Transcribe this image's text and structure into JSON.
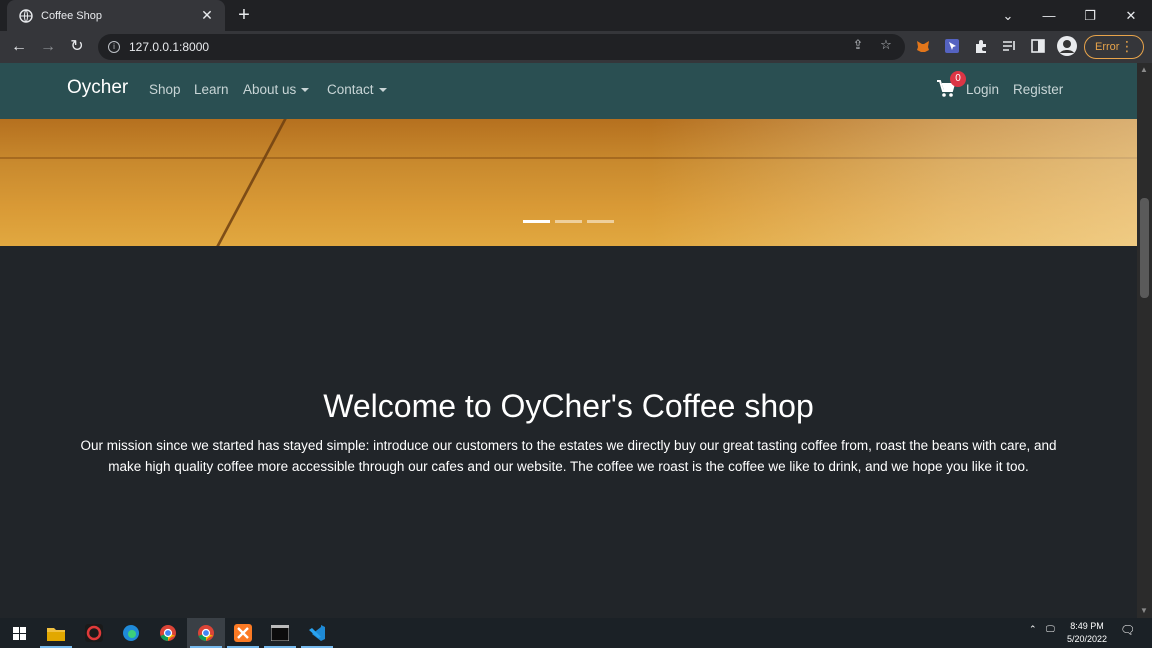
{
  "browser": {
    "tab_title": "Coffee Shop",
    "url": "127.0.0.1:8000",
    "error_label": "Error"
  },
  "site": {
    "brand": "Oycher",
    "nav": {
      "shop": "Shop",
      "learn": "Learn",
      "about": "About us",
      "contact": "Contact",
      "login": "Login",
      "register": "Register",
      "cart_count": "0"
    },
    "carousel": {
      "slide_count": 3,
      "active_index": 0
    },
    "welcome_title": "Welcome to OyCher's Coffee shop",
    "mission_line1": "Our mission since we started has stayed simple: introduce our customers to the estates we directly buy our great tasting coffee from, roast the beans with care, and",
    "mission_line2": "make high quality coffee more accessible through our cafes and our website. The coffee we roast is the coffee we like to drink, and we hope you like it too."
  },
  "taskbar": {
    "time": "8:49 PM",
    "date": "5/20/2022"
  },
  "colors": {
    "navbar": "#2a4f52",
    "page_bg": "#212529",
    "badge": "#dc3545",
    "error_accent": "#e8a44b"
  }
}
